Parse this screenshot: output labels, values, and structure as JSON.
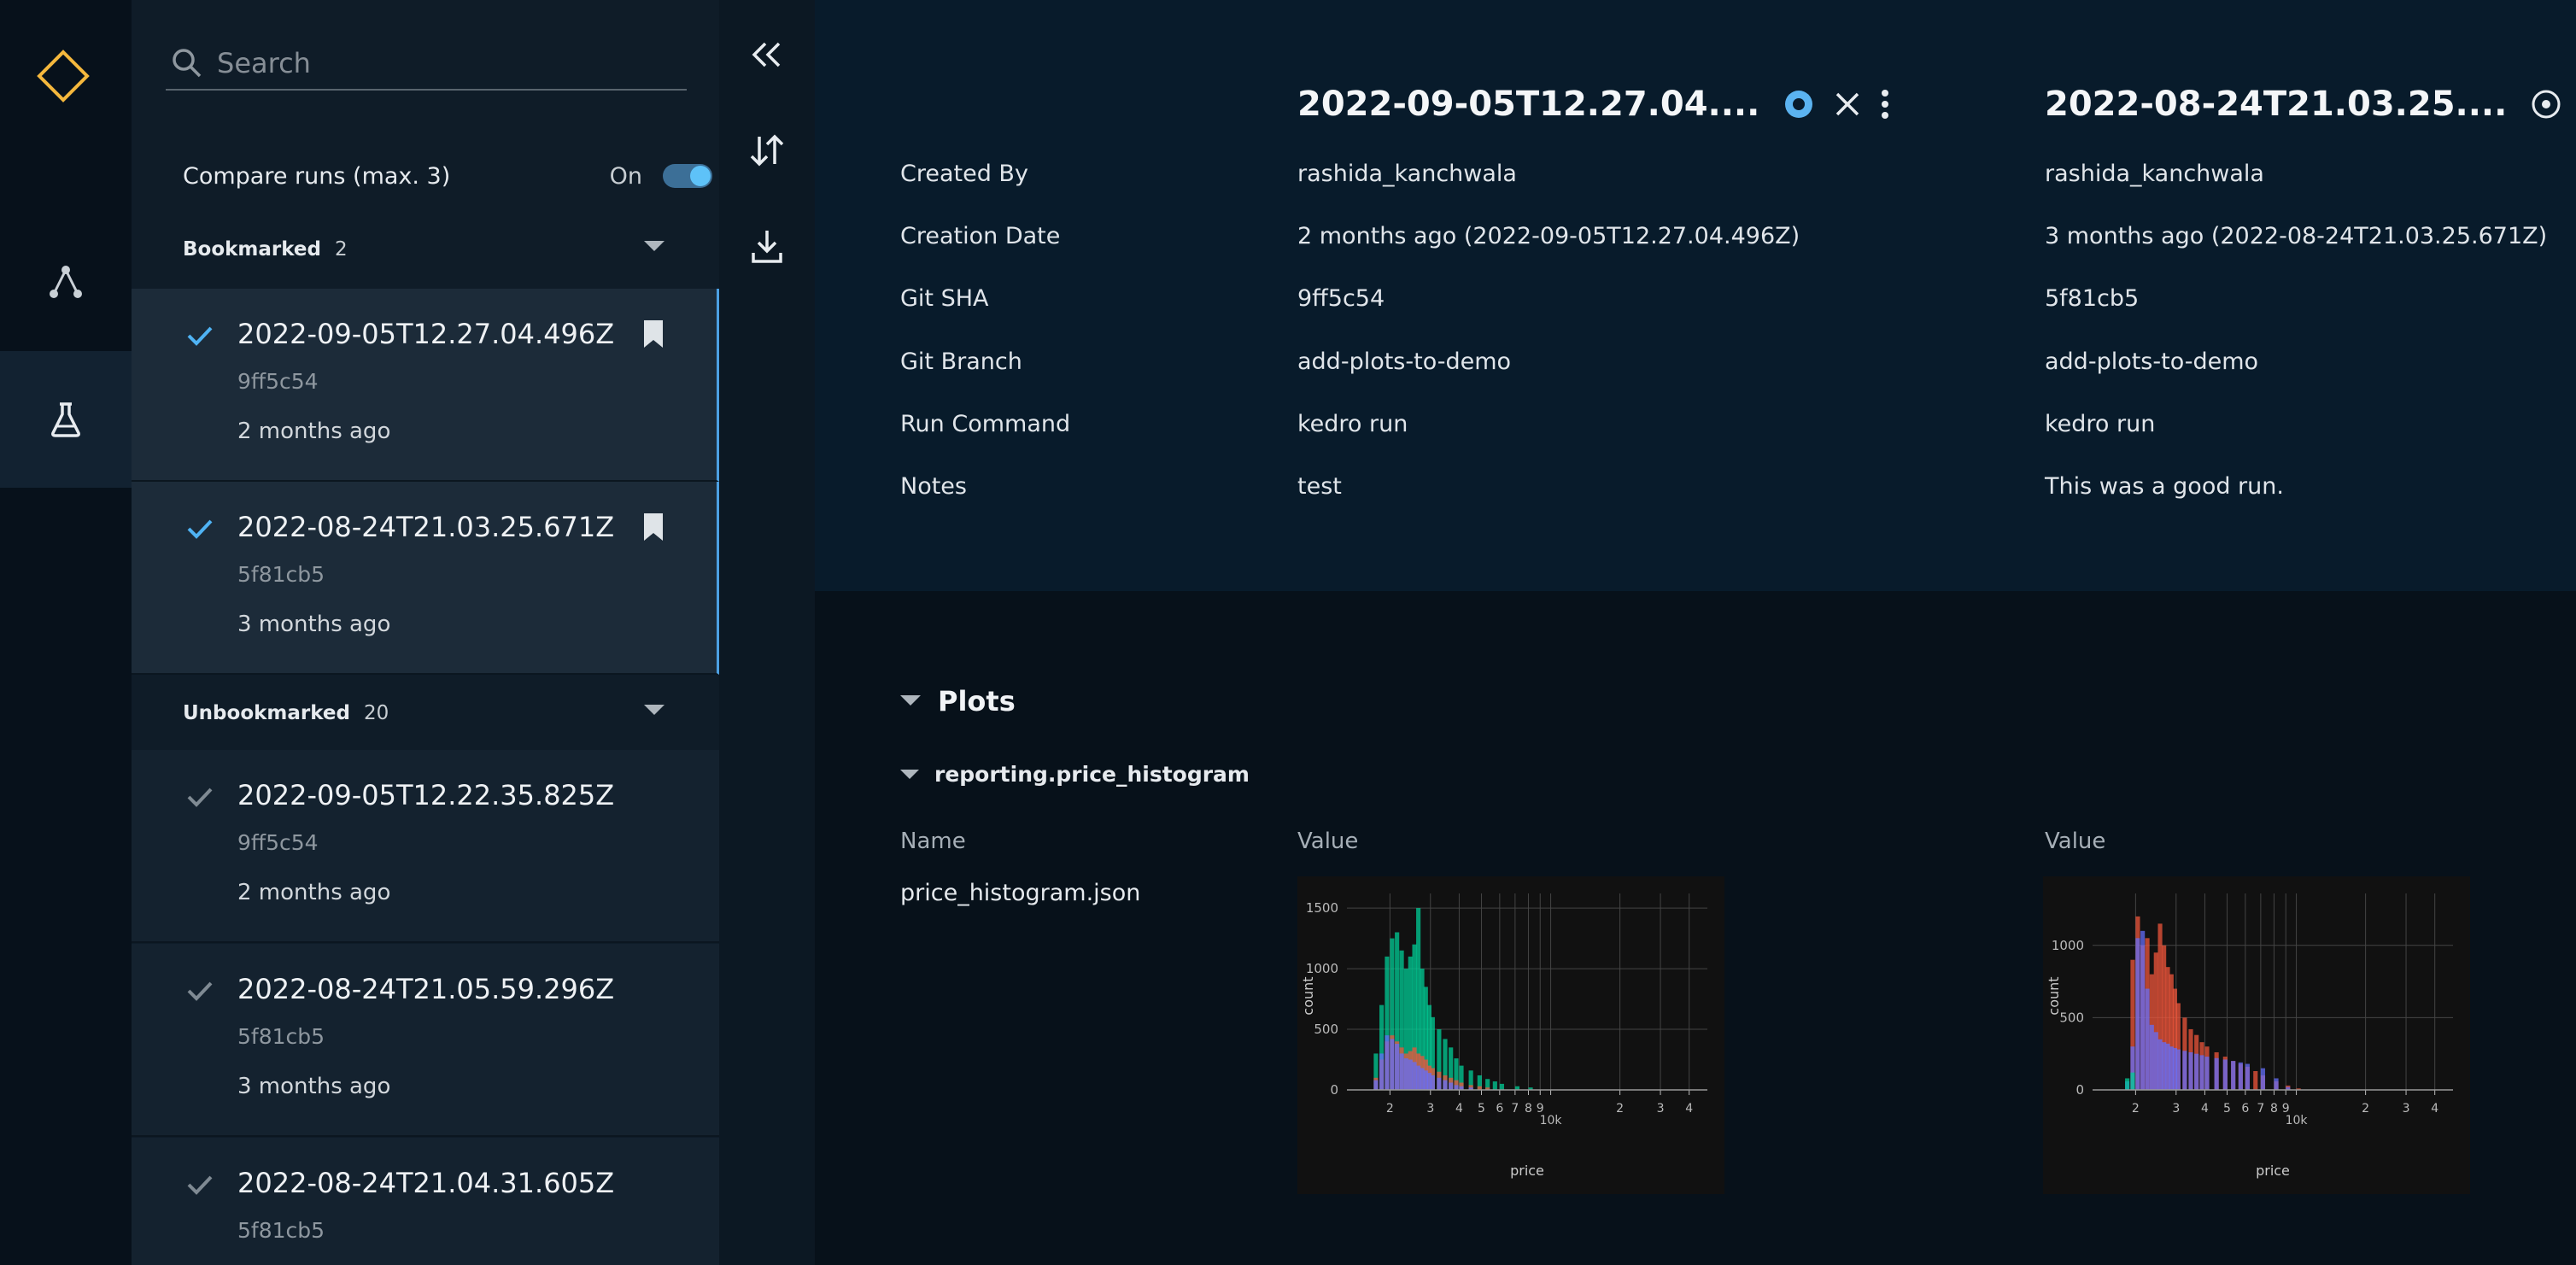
{
  "sidebar": {
    "search_placeholder": "Search",
    "compare_label": "Compare runs (max. 3)",
    "compare_state": "On",
    "groups": [
      {
        "title": "Bookmarked",
        "count": "2"
      },
      {
        "title": "Unbookmarked",
        "count": "20"
      }
    ],
    "runs": [
      {
        "title": "2022-09-05T12.27.04.496Z",
        "sha": "9ff5c54",
        "ago": "2 months ago"
      },
      {
        "title": "2022-08-24T21.03.25.671Z",
        "sha": "5f81cb5",
        "ago": "3 months ago"
      },
      {
        "title": "2022-09-05T12.22.35.825Z",
        "sha": "9ff5c54",
        "ago": "2 months ago"
      },
      {
        "title": "2022-08-24T21.05.59.296Z",
        "sha": "5f81cb5",
        "ago": "3 months ago"
      },
      {
        "title": "2022-08-24T21.04.31.605Z",
        "sha": "5f81cb5",
        "ago": ""
      }
    ]
  },
  "details": {
    "run_titles": [
      "2022-09-05T12.27.04....",
      "2022-08-24T21.03.25...."
    ],
    "labels": {
      "created_by": "Created By",
      "creation_date": "Creation Date",
      "git_sha": "Git SHA",
      "git_branch": "Git Branch",
      "run_command": "Run Command",
      "notes": "Notes"
    },
    "runs": [
      {
        "created_by": "rashida_kanchwala",
        "creation_date": "2 months ago (2022-09-05T12.27.04.496Z)",
        "git_sha": "9ff5c54",
        "git_branch": "add-plots-to-demo",
        "run_command": "kedro run",
        "notes": "test"
      },
      {
        "created_by": "rashida_kanchwala",
        "creation_date": "3 months ago (2022-08-24T21.03.25.671Z)",
        "git_sha": "5f81cb5",
        "git_branch": "add-plots-to-demo",
        "run_command": "kedro run",
        "notes": "This was a good run."
      }
    ]
  },
  "plots": {
    "section_title": "Plots",
    "dataset_title": "reporting.price_histogram",
    "name_header": "Name",
    "value_header": "Value",
    "file_name": "price_histogram.json"
  },
  "chart_data": [
    {
      "type": "bar",
      "xlabel": "price",
      "ylabel": "count",
      "x_scale": "log",
      "x_tick_labels": [
        "2",
        "3",
        "4",
        "5",
        "6",
        "7",
        "8",
        "9",
        "10k",
        "2",
        "3",
        "4"
      ],
      "y_ticks": [
        0,
        500,
        1000,
        1500
      ],
      "ylim": [
        0,
        1550
      ],
      "series": [
        {
          "color": "#00cc96",
          "x": [
            1700,
            1800,
            1900,
            2000,
            2100,
            2200,
            2300,
            2400,
            2500,
            2600,
            2700,
            2800,
            2900,
            3000,
            3200,
            3400,
            3600,
            3800,
            4000,
            4400,
            4800,
            5200,
            5600,
            6000,
            7000,
            8000
          ],
          "values": [
            300,
            700,
            1100,
            1250,
            1300,
            1150,
            1000,
            1100,
            1200,
            1500,
            1000,
            850,
            700,
            600,
            500,
            420,
            350,
            260,
            200,
            160,
            120,
            90,
            70,
            50,
            30,
            20
          ]
        },
        {
          "color": "#ef553b",
          "x": [
            1700,
            1800,
            1900,
            2000,
            2100,
            2200,
            2300,
            2400,
            2500,
            2600,
            2700,
            2800,
            2900,
            3000,
            3200,
            3400,
            3600,
            3800,
            4000,
            4400,
            4800,
            5200
          ],
          "values": [
            100,
            250,
            400,
            450,
            400,
            350,
            300,
            320,
            350,
            300,
            280,
            250,
            200,
            180,
            150,
            120,
            100,
            80,
            60,
            40,
            30,
            20
          ]
        },
        {
          "color": "#636efa",
          "x": [
            1700,
            1800,
            1900,
            2000,
            2100,
            2200,
            2300,
            2400,
            2500,
            2600,
            2700,
            2800,
            2900,
            3000,
            3200,
            3400,
            3600,
            3800,
            4000,
            4400
          ],
          "values": [
            80,
            300,
            450,
            420,
            380,
            300,
            260,
            250,
            230,
            200,
            180,
            160,
            140,
            120,
            100,
            80,
            60,
            40,
            30,
            20
          ]
        }
      ]
    },
    {
      "type": "bar",
      "xlabel": "price",
      "ylabel": "count",
      "x_scale": "log",
      "x_tick_labels": [
        "2",
        "3",
        "4",
        "5",
        "6",
        "7",
        "8",
        "9",
        "10k",
        "2",
        "3",
        "4"
      ],
      "y_ticks": [
        0,
        500,
        1000
      ],
      "ylim": [
        0,
        1300
      ],
      "series": [
        {
          "color": "#ef553b",
          "x": [
            1900,
            2000,
            2100,
            2200,
            2300,
            2400,
            2500,
            2600,
            2700,
            2800,
            2900,
            3000,
            3200,
            3400,
            3600,
            3800,
            4000,
            4400,
            4800,
            5200,
            5600,
            6000,
            6500,
            7000,
            8000,
            9000,
            10000
          ],
          "values": [
            900,
            1200,
            1000,
            1050,
            800,
            950,
            1150,
            1000,
            850,
            800,
            700,
            600,
            500,
            420,
            380,
            330,
            300,
            260,
            230,
            200,
            180,
            160,
            130,
            100,
            60,
            30,
            10
          ]
        },
        {
          "color": "#636efa",
          "x": [
            1800,
            1900,
            2000,
            2100,
            2200,
            2300,
            2400,
            2500,
            2600,
            2700,
            2800,
            2900,
            3000,
            3200,
            3400,
            3600,
            3800,
            4000,
            4400,
            4800,
            5200,
            5600,
            6000,
            7000,
            8000,
            9000
          ],
          "values": [
            60,
            300,
            1050,
            1100,
            700,
            450,
            400,
            350,
            330,
            320,
            300,
            290,
            280,
            270,
            260,
            250,
            240,
            230,
            220,
            210,
            200,
            190,
            180,
            150,
            80,
            20
          ]
        },
        {
          "color": "#00cc96",
          "x": [
            1800,
            1900
          ],
          "values": [
            80,
            120
          ]
        }
      ]
    }
  ]
}
